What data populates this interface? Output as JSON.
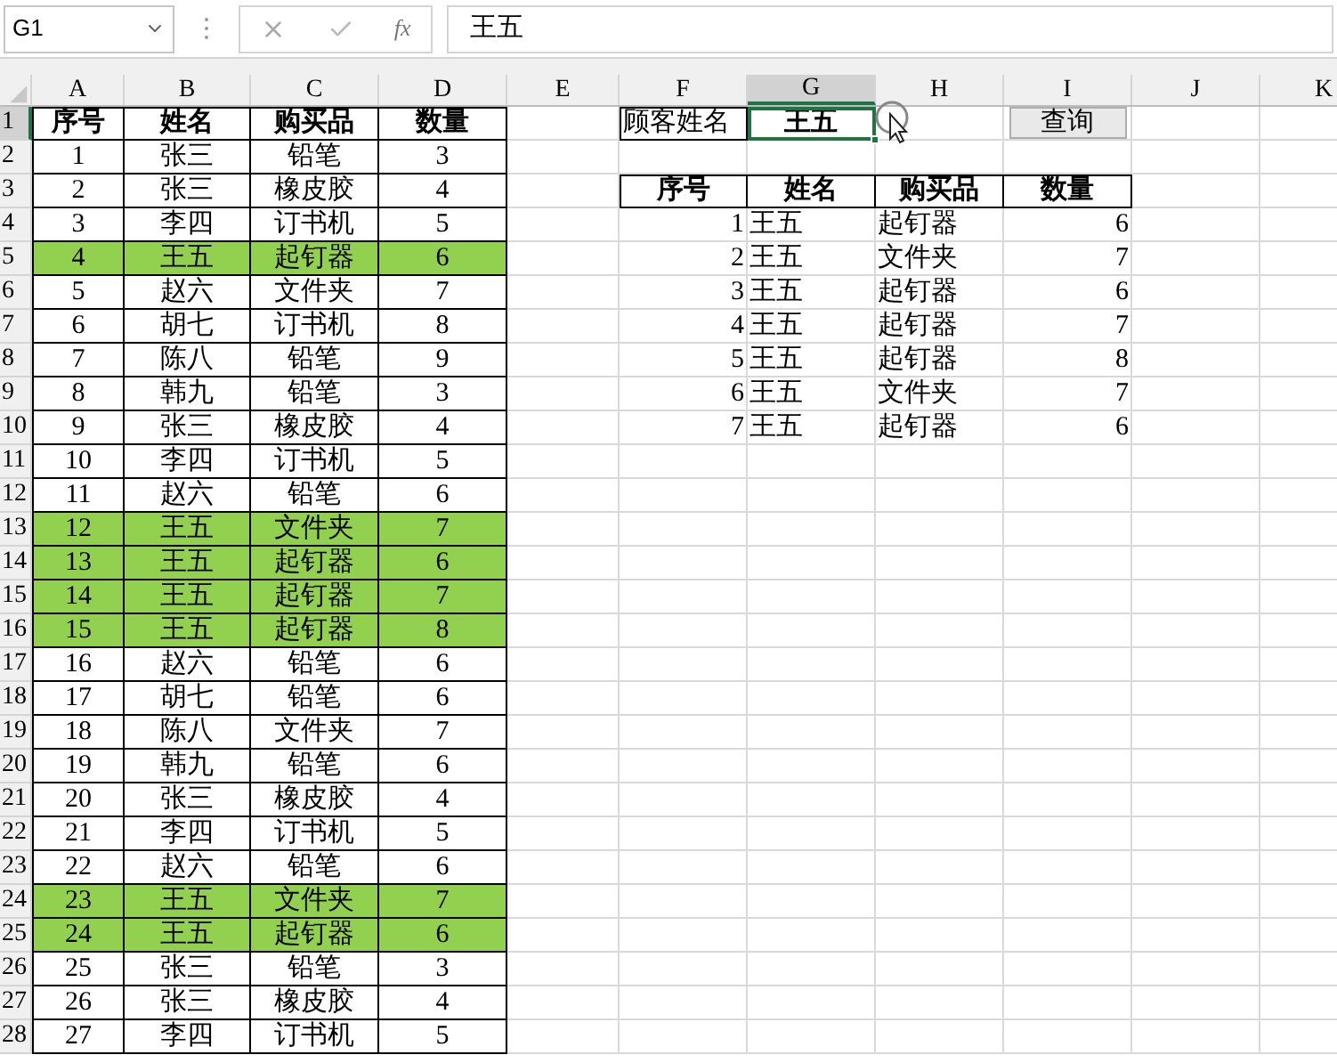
{
  "formula_bar": {
    "name_box": "G1",
    "function_label": "fx",
    "formula": "王五"
  },
  "column_headers": [
    {
      "label": "A",
      "selected": false
    },
    {
      "label": "B",
      "selected": false
    },
    {
      "label": "C",
      "selected": false
    },
    {
      "label": "D",
      "selected": false
    },
    {
      "label": "E",
      "selected": false
    },
    {
      "label": "F",
      "selected": false
    },
    {
      "label": "G",
      "selected": true
    },
    {
      "label": "H",
      "selected": false
    },
    {
      "label": "I",
      "selected": false
    },
    {
      "label": "J",
      "selected": false
    },
    {
      "label": "K",
      "selected": false
    }
  ],
  "row_headers": [
    {
      "label": "1",
      "selected": true
    },
    {
      "label": "2",
      "selected": false
    },
    {
      "label": "3",
      "selected": false
    },
    {
      "label": "4",
      "selected": false
    },
    {
      "label": "5",
      "selected": false
    },
    {
      "label": "6",
      "selected": false
    },
    {
      "label": "7",
      "selected": false
    },
    {
      "label": "8",
      "selected": false
    },
    {
      "label": "9",
      "selected": false
    },
    {
      "label": "10",
      "selected": false
    },
    {
      "label": "11",
      "selected": false
    },
    {
      "label": "12",
      "selected": false
    },
    {
      "label": "13",
      "selected": false
    },
    {
      "label": "14",
      "selected": false
    },
    {
      "label": "15",
      "selected": false
    },
    {
      "label": "16",
      "selected": false
    },
    {
      "label": "17",
      "selected": false
    },
    {
      "label": "18",
      "selected": false
    },
    {
      "label": "19",
      "selected": false
    },
    {
      "label": "20",
      "selected": false
    },
    {
      "label": "21",
      "selected": false
    },
    {
      "label": "22",
      "selected": false
    },
    {
      "label": "23",
      "selected": false
    },
    {
      "label": "24",
      "selected": false
    },
    {
      "label": "25",
      "selected": false
    },
    {
      "label": "26",
      "selected": false
    },
    {
      "label": "27",
      "selected": false
    },
    {
      "label": "28",
      "selected": false
    }
  ],
  "orders_table": {
    "header": [
      "序号",
      "姓名",
      "购买品",
      "数量"
    ],
    "rows": [
      {
        "cells": [
          "1",
          "张三",
          "铅笔",
          "3"
        ],
        "highlighted": false
      },
      {
        "cells": [
          "2",
          "张三",
          "橡皮胶",
          "4"
        ],
        "highlighted": false
      },
      {
        "cells": [
          "3",
          "李四",
          "订书机",
          "5"
        ],
        "highlighted": false
      },
      {
        "cells": [
          "4",
          "王五",
          "起钉器",
          "6"
        ],
        "highlighted": true
      },
      {
        "cells": [
          "5",
          "赵六",
          "文件夹",
          "7"
        ],
        "highlighted": false
      },
      {
        "cells": [
          "6",
          "胡七",
          "订书机",
          "8"
        ],
        "highlighted": false
      },
      {
        "cells": [
          "7",
          "陈八",
          "铅笔",
          "9"
        ],
        "highlighted": false
      },
      {
        "cells": [
          "8",
          "韩九",
          "铅笔",
          "3"
        ],
        "highlighted": false
      },
      {
        "cells": [
          "9",
          "张三",
          "橡皮胶",
          "4"
        ],
        "highlighted": false
      },
      {
        "cells": [
          "10",
          "李四",
          "订书机",
          "5"
        ],
        "highlighted": false
      },
      {
        "cells": [
          "11",
          "赵六",
          "铅笔",
          "6"
        ],
        "highlighted": false
      },
      {
        "cells": [
          "12",
          "王五",
          "文件夹",
          "7"
        ],
        "highlighted": true
      },
      {
        "cells": [
          "13",
          "王五",
          "起钉器",
          "6"
        ],
        "highlighted": true
      },
      {
        "cells": [
          "14",
          "王五",
          "起钉器",
          "7"
        ],
        "highlighted": true
      },
      {
        "cells": [
          "15",
          "王五",
          "起钉器",
          "8"
        ],
        "highlighted": true
      },
      {
        "cells": [
          "16",
          "赵六",
          "铅笔",
          "6"
        ],
        "highlighted": false
      },
      {
        "cells": [
          "17",
          "胡七",
          "铅笔",
          "6"
        ],
        "highlighted": false
      },
      {
        "cells": [
          "18",
          "陈八",
          "文件夹",
          "7"
        ],
        "highlighted": false
      },
      {
        "cells": [
          "19",
          "韩九",
          "铅笔",
          "6"
        ],
        "highlighted": false
      },
      {
        "cells": [
          "20",
          "张三",
          "橡皮胶",
          "4"
        ],
        "highlighted": false
      },
      {
        "cells": [
          "21",
          "李四",
          "订书机",
          "5"
        ],
        "highlighted": false
      },
      {
        "cells": [
          "22",
          "赵六",
          "铅笔",
          "6"
        ],
        "highlighted": false
      },
      {
        "cells": [
          "23",
          "王五",
          "文件夹",
          "7"
        ],
        "highlighted": true
      },
      {
        "cells": [
          "24",
          "王五",
          "起钉器",
          "6"
        ],
        "highlighted": true
      },
      {
        "cells": [
          "25",
          "张三",
          "铅笔",
          "3"
        ],
        "highlighted": false
      },
      {
        "cells": [
          "26",
          "张三",
          "橡皮胶",
          "4"
        ],
        "highlighted": false
      },
      {
        "cells": [
          "27",
          "李四",
          "订书机",
          "5"
        ],
        "highlighted": false
      }
    ]
  },
  "lookup": {
    "label": "顾客姓名",
    "value": "王五",
    "selected": true,
    "button": "查询"
  },
  "results_table": {
    "header": [
      "序号",
      "姓名",
      "购买品",
      "数量"
    ],
    "rows": [
      [
        "1",
        "王五",
        "起钉器",
        "6"
      ],
      [
        "2",
        "王五",
        "文件夹",
        "7"
      ],
      [
        "3",
        "王五",
        "起钉器",
        "6"
      ],
      [
        "4",
        "王五",
        "起钉器",
        "7"
      ],
      [
        "5",
        "王五",
        "起钉器",
        "8"
      ],
      [
        "6",
        "王五",
        "文件夹",
        "7"
      ],
      [
        "7",
        "王五",
        "起钉器",
        "6"
      ]
    ]
  }
}
